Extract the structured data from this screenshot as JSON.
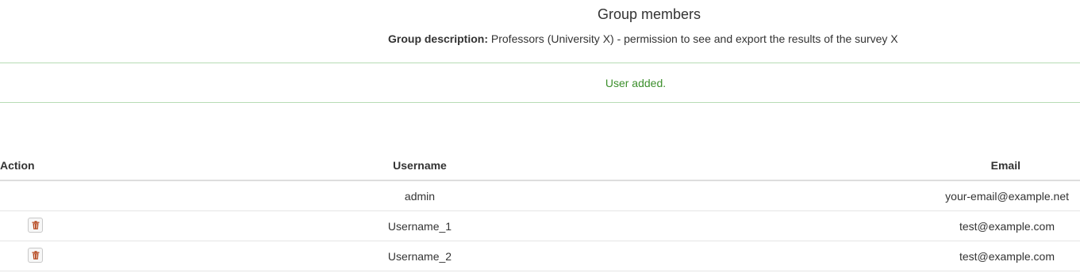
{
  "header": {
    "title": "Group members",
    "description_label": "Group description:",
    "description_text": "Professors (University X) - permission to see and export the results of the survey X"
  },
  "alert": {
    "message": "User added."
  },
  "table": {
    "columns": {
      "action": "Action",
      "username": "Username",
      "email": "Email"
    },
    "rows": [
      {
        "username": "admin",
        "email": "your-email@example.net",
        "deletable": false
      },
      {
        "username": "Username_1",
        "email": "test@example.com",
        "deletable": true
      },
      {
        "username": "Username_2",
        "email": "test@example.com",
        "deletable": true
      }
    ]
  },
  "colors": {
    "alert_text": "#3c8f2c",
    "alert_border": "#b7dcb5",
    "trash_icon": "#b5451b"
  },
  "icons": {
    "delete": "trash-icon"
  }
}
